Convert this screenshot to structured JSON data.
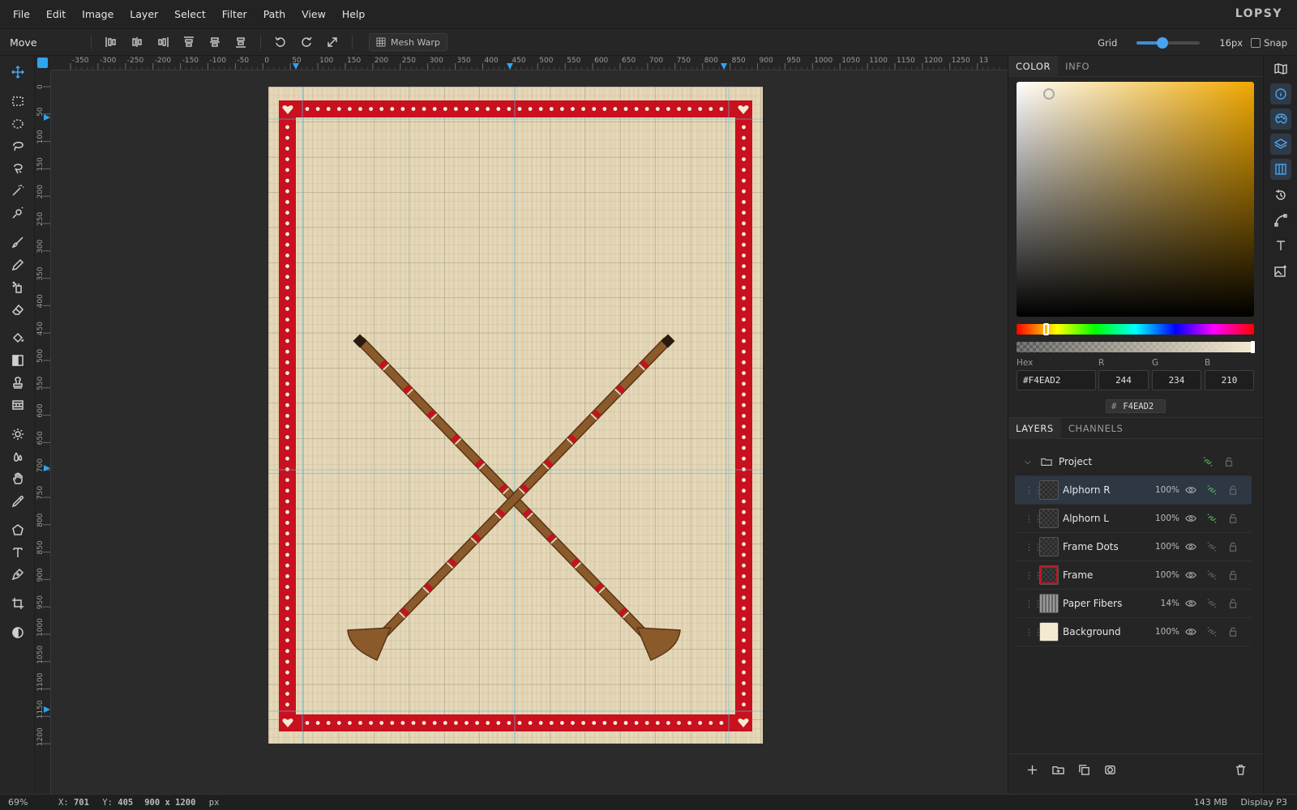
{
  "app": {
    "brand": "LOPSY"
  },
  "menu": [
    "File",
    "Edit",
    "Image",
    "Layer",
    "Select",
    "Filter",
    "Path",
    "View",
    "Help"
  ],
  "options": {
    "tool_name": "Move",
    "mesh_warp_label": "Mesh Warp",
    "grid_label": "Grid",
    "grid_value": "16px",
    "grid_slider_fraction": 0.4,
    "snap_label": "Snap",
    "snap_checked": false
  },
  "ruler": {
    "top_labels": [
      "-350",
      "-300",
      "-250",
      "-200",
      "-150",
      "-100",
      "-50",
      "0",
      "50",
      "100",
      "150",
      "200",
      "250",
      "300",
      "350",
      "400",
      "450",
      "500",
      "550",
      "600",
      "650",
      "700",
      "750",
      "800",
      "850",
      "900",
      "950",
      "1000",
      "1050",
      "1100",
      "1150",
      "1200",
      "1250",
      "13"
    ],
    "left_labels": [
      "0",
      "50",
      "100",
      "150",
      "200",
      "250",
      "300",
      "350",
      "400",
      "450",
      "500",
      "550",
      "600",
      "650",
      "700",
      "750",
      "800",
      "850",
      "900",
      "950",
      "1000",
      "1050",
      "1100",
      "1150",
      "1200"
    ]
  },
  "color_panel": {
    "tabs": [
      "COLOR",
      "INFO"
    ],
    "hex_label": "Hex",
    "hex_value": "#F4EAD2",
    "r_label": "R",
    "r_value": "244",
    "g_label": "G",
    "g_value": "234",
    "b_label": "B",
    "b_value": "210",
    "chip_hash": "#",
    "chip_value": "F4EAD2",
    "current_color": "#F4EAD2"
  },
  "layers_panel": {
    "tabs": [
      "LAYERS",
      "CHANNELS"
    ],
    "group_name": "Project",
    "layers": [
      {
        "name": "Alphorn R",
        "opacity": "100%",
        "selected": true
      },
      {
        "name": "Alphorn L",
        "opacity": "100%",
        "selected": false
      },
      {
        "name": "Frame Dots",
        "opacity": "100%",
        "selected": false
      },
      {
        "name": "Frame",
        "opacity": "100%",
        "selected": false
      },
      {
        "name": "Paper Fibers",
        "opacity": "14%",
        "selected": false
      },
      {
        "name": "Background",
        "opacity": "100%",
        "selected": false
      }
    ]
  },
  "status": {
    "zoom": "69%",
    "x_label": "X:",
    "x_value": "701",
    "y_label": "Y:",
    "y_value": "405",
    "doc_size": "900 x 1200",
    "doc_unit": "px",
    "memory": "143 MB",
    "color_profile": "Display P3"
  },
  "colors": {
    "accent": "#2fa4f0",
    "frame_red": "#c8101e",
    "paper": "#e4d7b8",
    "alphorn": "#8b5a2b"
  }
}
